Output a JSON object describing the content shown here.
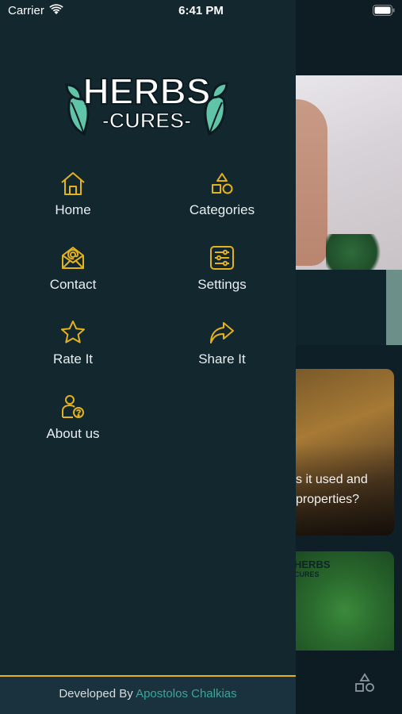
{
  "status_bar": {
    "carrier": "Carrier",
    "time": "6:41 PM",
    "wifi_icon": "wifi-icon",
    "battery_icon": "battery-icon"
  },
  "drawer": {
    "logo": {
      "line1": "HERBS",
      "line2": "-CURES-",
      "icon": "leaf-icon"
    },
    "menu": [
      {
        "label": "Home",
        "icon": "home-icon"
      },
      {
        "label": "Categories",
        "icon": "shapes-icon"
      },
      {
        "label": "Contact",
        "icon": "mail-at-icon"
      },
      {
        "label": "Settings",
        "icon": "sliders-icon"
      },
      {
        "label": "Rate It",
        "icon": "star-icon"
      },
      {
        "label": "Share It",
        "icon": "share-arrow-icon"
      },
      {
        "label": "About us",
        "icon": "user-question-icon"
      }
    ],
    "footer": {
      "prefix": "Developed By",
      "author": "Apostolos Chalkias"
    }
  },
  "background_page": {
    "article_text_line1": "s it used and",
    "article_text_line2": "properties?",
    "mini_logo_line1": "HERBS",
    "mini_logo_line2": "CURES",
    "tab_icon": "shapes-icon"
  },
  "colors": {
    "accent": "#e4b21a",
    "drawer_bg": "#13272f",
    "footer_bg": "#1a323d",
    "author_link": "#3aa59b",
    "logo_green": "#5fc4a8"
  }
}
